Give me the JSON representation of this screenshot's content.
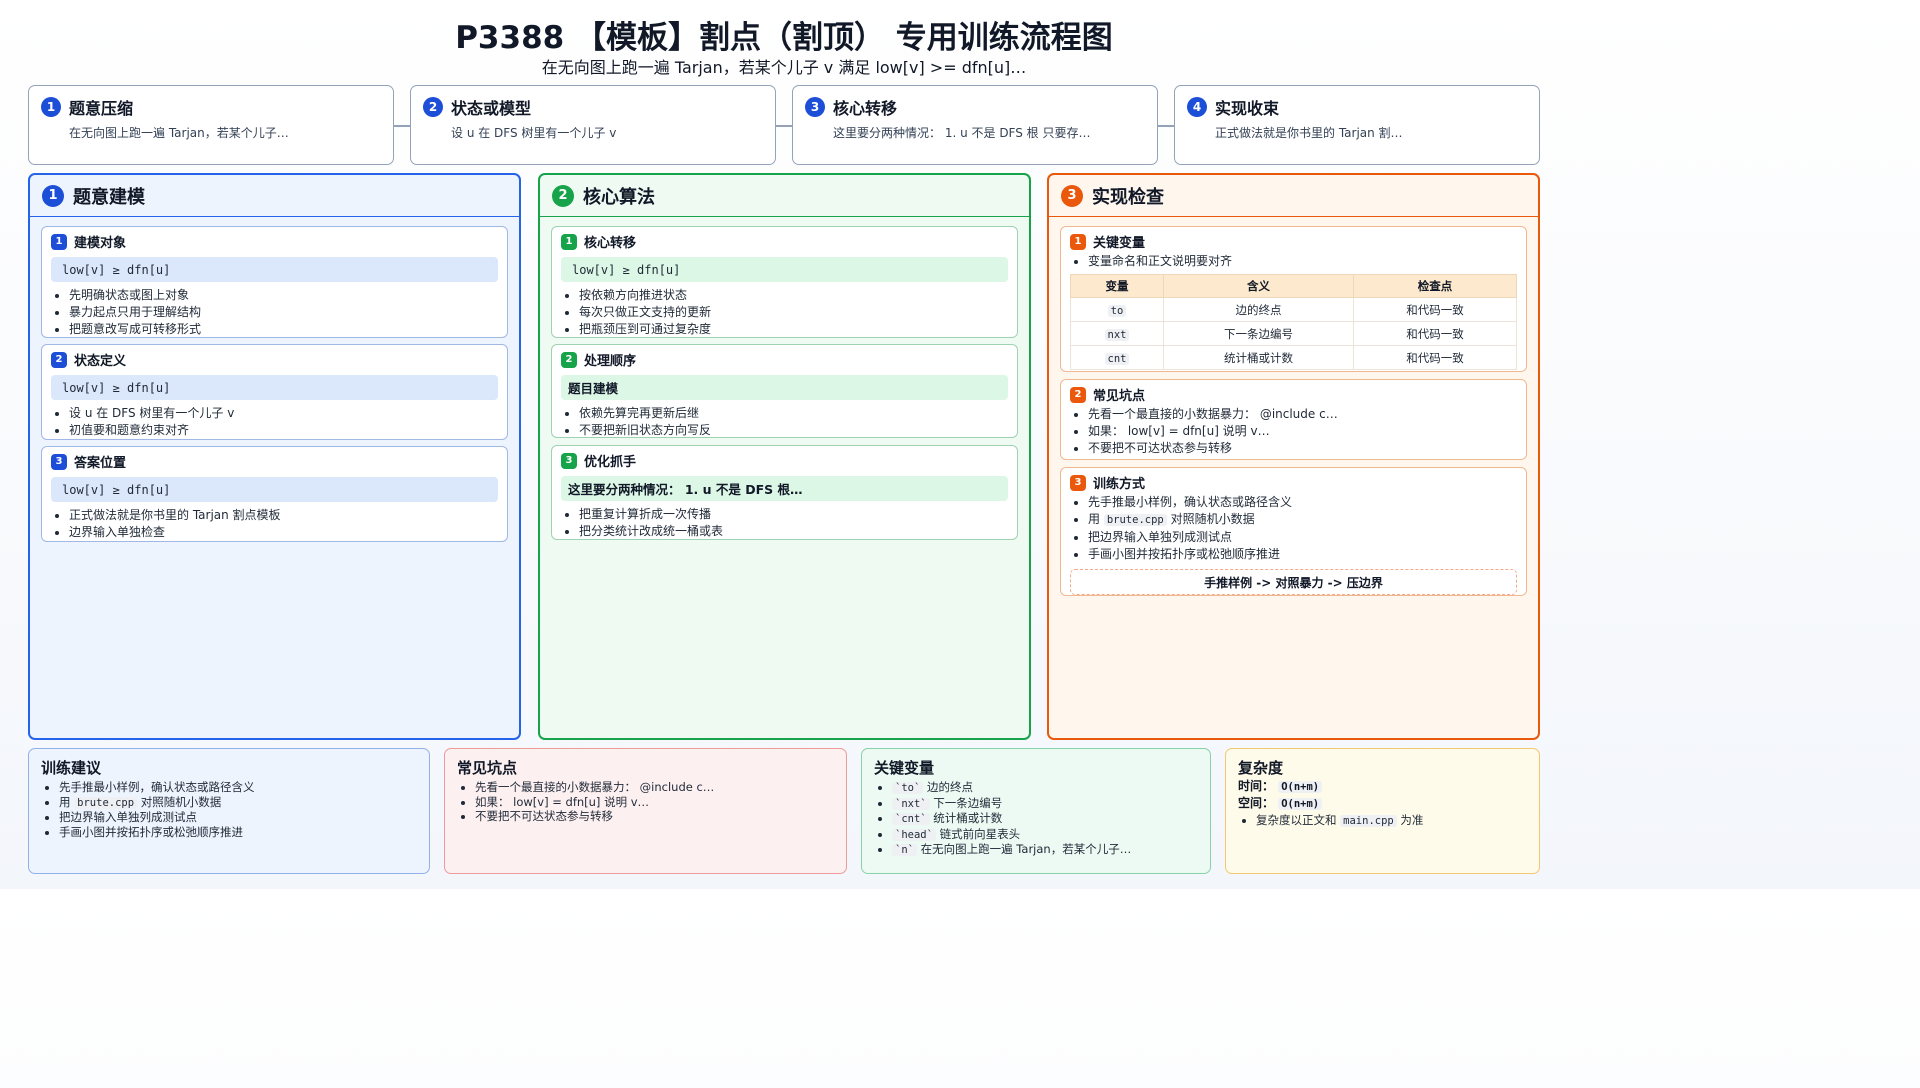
{
  "header": {
    "title": "P3388 【模板】割点（割顶） 专用训练流程图",
    "subtitle": "在无向图上跑一遍 Tarjan，若某个儿子 v 满足 low[v] >= dfn[u]…"
  },
  "flow_steps": [
    {
      "num": "1",
      "title": "题意压缩",
      "desc": "在无向图上跑一遍 Tarjan，若某个儿子…"
    },
    {
      "num": "2",
      "title": "状态或模型",
      "desc": "设 u 在 DFS 树里有一个儿子 v"
    },
    {
      "num": "3",
      "title": "核心转移",
      "desc": "这里要分两种情况： 1. u 不是 DFS 根 只要存…"
    },
    {
      "num": "4",
      "title": "实现收束",
      "desc": "正式做法就是你书里的 Tarjan 割…"
    }
  ],
  "columns": {
    "modeling": {
      "num": "1",
      "title": "题意建模",
      "cards": [
        {
          "num": "1",
          "title": "建模对象",
          "code": "low[v] ≥ dfn[u]",
          "bullets": [
            "先明确状态或图上对象",
            "暴力起点只用于理解结构",
            "把题意改写成可转移形式"
          ]
        },
        {
          "num": "2",
          "title": "状态定义",
          "code": "low[v] ≥ dfn[u]",
          "bullets": [
            "设 u 在 DFS 树里有一个儿子 v",
            "初值要和题意约束对齐"
          ]
        },
        {
          "num": "3",
          "title": "答案位置",
          "code": "low[v] ≥ dfn[u]",
          "bullets": [
            "正式做法就是你书里的 Tarjan 割点模板",
            "边界输入单独检查"
          ]
        }
      ]
    },
    "algorithm": {
      "num": "2",
      "title": "核心算法",
      "cards": [
        {
          "num": "1",
          "title": "核心转移",
          "code": "low[v] ≥ dfn[u]",
          "bullets": [
            "按依赖方向推进状态",
            "每次只做正文支持的更新",
            "把瓶颈压到可通过复杂度"
          ]
        },
        {
          "num": "2",
          "title": "处理顺序",
          "bar": "题目建模",
          "bullets": [
            "依赖先算完再更新后继",
            "不要把新旧状态方向写反"
          ]
        },
        {
          "num": "3",
          "title": "优化抓手",
          "bar": "这里要分两种情况： 1. u 不是 DFS 根…",
          "bullets": [
            "把重复计算折成一次传播",
            "把分类统计改成统一桶或表"
          ]
        }
      ]
    },
    "check": {
      "num": "3",
      "title": "实现检查",
      "vars_card": {
        "num": "1",
        "title": "关键变量",
        "note": "变量命名和正文说明要对齐",
        "headers": [
          "变量",
          "含义",
          "检查点"
        ],
        "rows": [
          {
            "var": "to",
            "meaning": "边的终点",
            "check": "和代码一致"
          },
          {
            "var": "nxt",
            "meaning": "下一条边编号",
            "check": "和代码一致"
          },
          {
            "var": "cnt",
            "meaning": "统计桶或计数",
            "check": "和代码一致"
          }
        ]
      },
      "pitfalls_card": {
        "num": "2",
        "title": "常见坑点",
        "bullets": [
          "先看一个最直接的小数据暴力： @include c…",
          "如果： low[v] = dfn[u] 说明 v…",
          "不要把不可达状态参与转移"
        ]
      },
      "training_card": {
        "num": "3",
        "title": "训练方式",
        "b1": "先手推最小样例，确认状态或路径含义",
        "b2_pre": "用",
        "b2_code": "brute.cpp",
        "b2_post": "对照随机小数据",
        "b3": "把边界输入单独列成测试点",
        "b4": "手画小图并按拓扑序或松弛顺序推进",
        "footer": "手推样例 -> 对照暴力 -> 压边界"
      }
    }
  },
  "bottom": {
    "advice": {
      "title": "训练建议",
      "b1": "先手推最小样例，确认状态或路径含义",
      "b2_pre": "用",
      "b2_code": "brute.cpp",
      "b2_post": "对照随机小数据",
      "b3": "把边界输入单独列成测试点",
      "b4": "手画小图并按拓扑序或松弛顺序推进"
    },
    "pitfalls": {
      "title": "常见坑点",
      "bullets": [
        "先看一个最直接的小数据暴力： @include c…",
        "如果： low[v] = dfn[u] 说明 v…",
        "不要把不可达状态参与转移"
      ]
    },
    "vars": {
      "title": "关键变量",
      "items": [
        {
          "code": "`to`",
          "text": "边的终点"
        },
        {
          "code": "`nxt`",
          "text": "下一条边编号"
        },
        {
          "code": "`cnt`",
          "text": "统计桶或计数"
        },
        {
          "code": "`head`",
          "text": "链式前向星表头"
        },
        {
          "code": "`n`",
          "text": "在无向图上跑一遍 Tarjan，若某个儿子…"
        }
      ]
    },
    "complexity": {
      "title": "复杂度",
      "time_label": "时间：",
      "time_value": "O(n+m)",
      "space_label": "空间：",
      "space_value": "O(n+m)",
      "note_pre": "复杂度以正文和",
      "note_code": "main.cpp",
      "note_post": "为准"
    }
  },
  "colors": {
    "blue": "#2563eb",
    "green": "#16a34a",
    "orange": "#ea580c"
  }
}
